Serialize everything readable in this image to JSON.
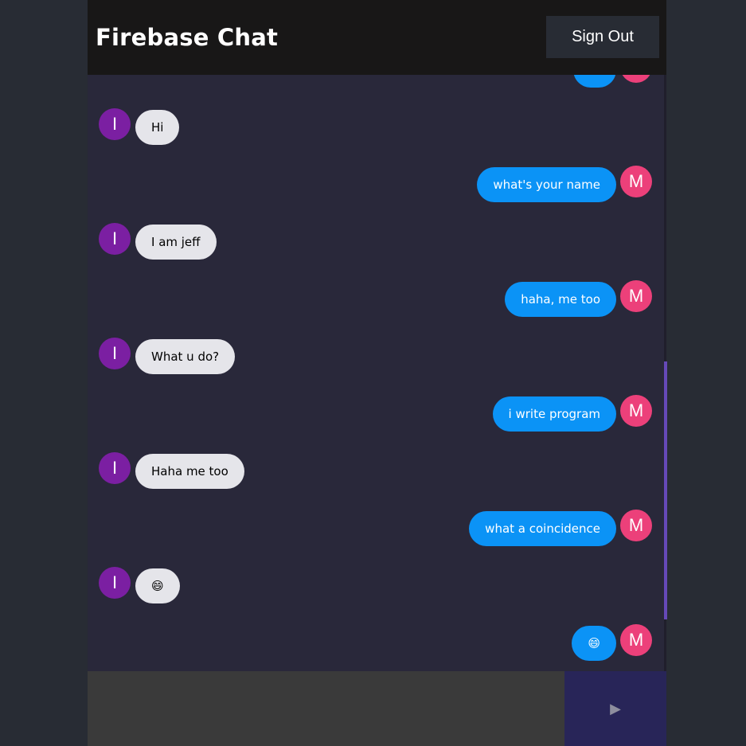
{
  "header": {
    "title": "Firebase Chat",
    "signout_label": "Sign Out"
  },
  "messages": [
    {
      "type": "sent",
      "text": "",
      "avatar": ""
    },
    {
      "type": "received",
      "text": "Hi",
      "avatar": "I"
    },
    {
      "type": "sent",
      "text": "what's your name",
      "avatar": "M"
    },
    {
      "type": "received",
      "text": "I am jeff",
      "avatar": "I"
    },
    {
      "type": "sent",
      "text": "haha, me too",
      "avatar": "M"
    },
    {
      "type": "received",
      "text": "What u do?",
      "avatar": "I"
    },
    {
      "type": "sent",
      "text": "i write program",
      "avatar": "M"
    },
    {
      "type": "received",
      "text": "Haha me too",
      "avatar": "I"
    },
    {
      "type": "sent",
      "text": "what a coincidence",
      "avatar": "M"
    },
    {
      "type": "received",
      "text": "😄",
      "avatar": "I"
    },
    {
      "type": "sent",
      "text": "😄",
      "avatar": "M"
    }
  ],
  "composer": {
    "input_value": "",
    "placeholder": "",
    "send_icon": "▶"
  },
  "colors": {
    "page_bg": "#282c34",
    "chat_bg": "#29283a",
    "header_bg": "#181717",
    "sent_bubble": "#0b93f6",
    "received_bubble": "#e5e5ea",
    "received_avatar": "#7b1fa2",
    "sent_avatar": "#ec407a",
    "send_button": "#282558",
    "scrollbar": "#6649b8"
  }
}
